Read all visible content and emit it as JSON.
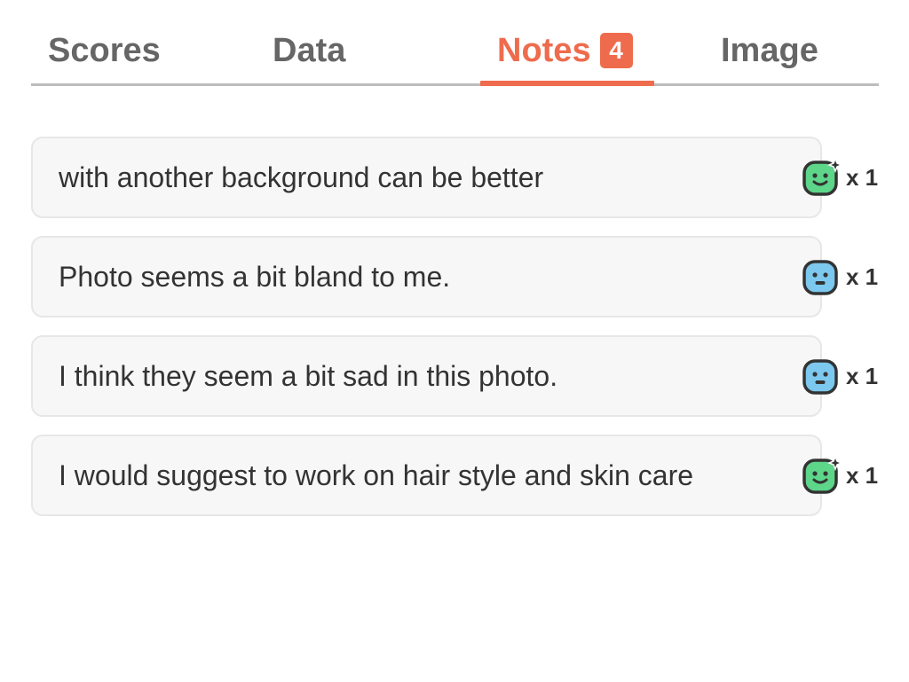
{
  "tabs": [
    {
      "label": "Scores",
      "active": false
    },
    {
      "label": "Data",
      "active": false
    },
    {
      "label": "Notes",
      "active": true,
      "badge": "4"
    },
    {
      "label": "Image",
      "active": false
    }
  ],
  "accent_color": "#ee6c4d",
  "notes": [
    {
      "text": "with another background can be better",
      "reaction": {
        "icon": "happy-face-icon",
        "color": "#5dd68a",
        "count": "x 1"
      }
    },
    {
      "text": "Photo seems a bit bland to me.",
      "reaction": {
        "icon": "neutral-face-icon",
        "color": "#7cc8ef",
        "count": "x 1"
      }
    },
    {
      "text": "I think they seem a bit sad in this photo.",
      "reaction": {
        "icon": "neutral-face-icon",
        "color": "#7cc8ef",
        "count": "x 1"
      }
    },
    {
      "text": "I would suggest to work on hair style and skin care",
      "reaction": {
        "icon": "happy-face-icon",
        "color": "#5dd68a",
        "count": "x 1"
      }
    }
  ]
}
